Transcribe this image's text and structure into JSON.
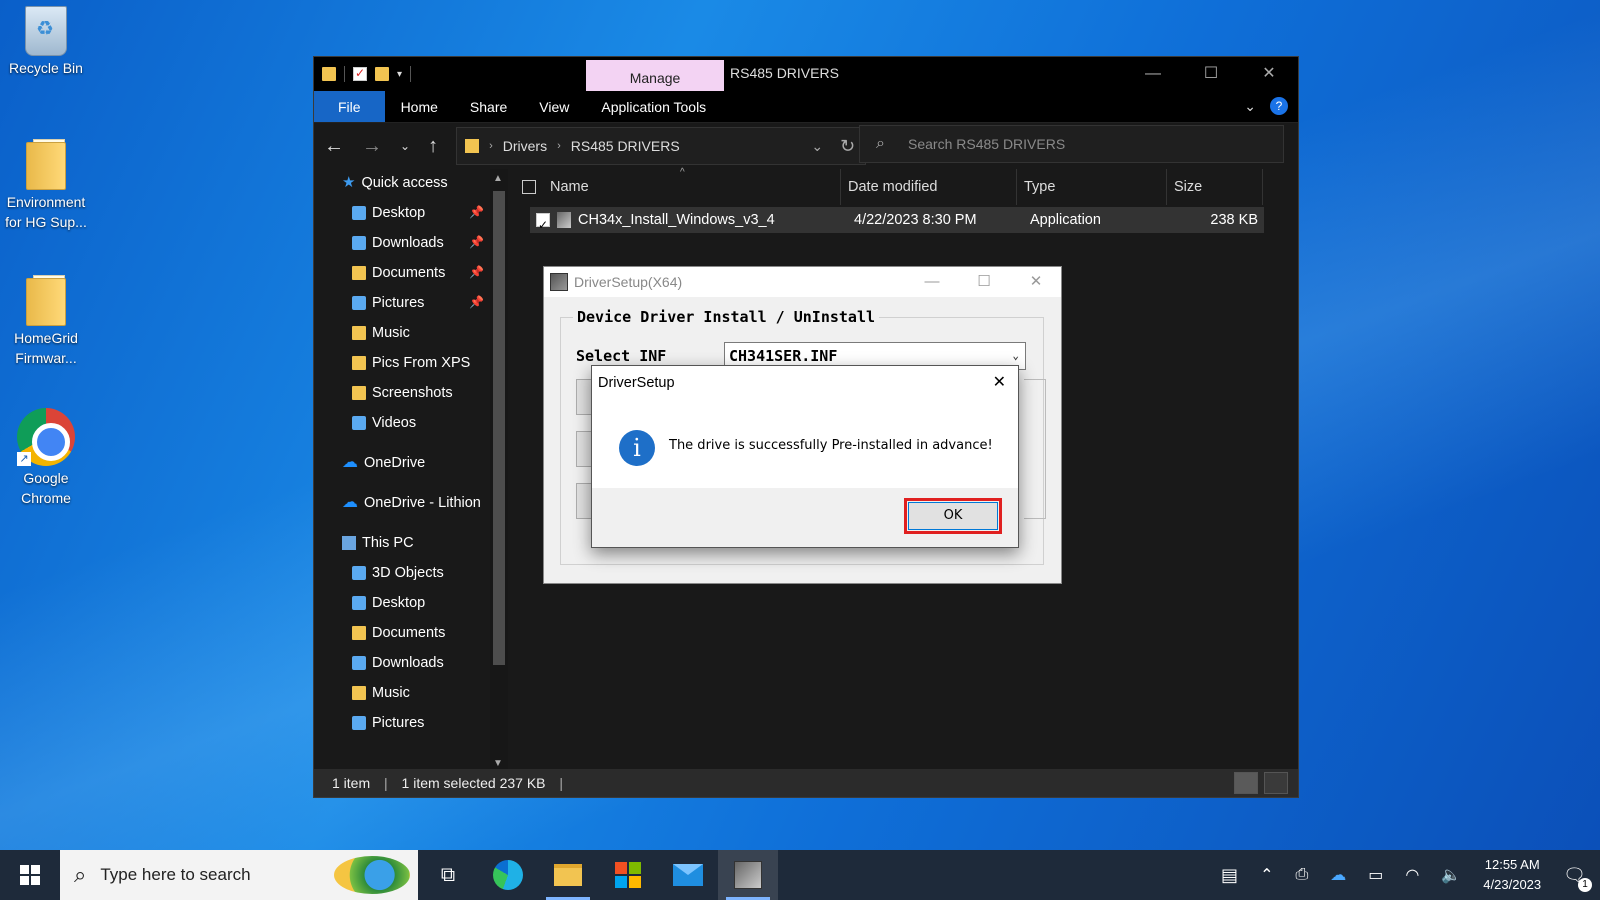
{
  "desktop": {
    "icons": [
      {
        "label": "Recycle Bin",
        "icon": "recycle-bin-icon"
      },
      {
        "label": "Environment for HG Sup...",
        "icon": "folder-icon"
      },
      {
        "label": "HomeGrid Firmwar...",
        "icon": "folder-icon"
      },
      {
        "label": "Google Chrome",
        "icon": "chrome-icon"
      }
    ]
  },
  "explorer": {
    "manage_tab": "Manage",
    "window_title": "RS485 DRIVERS",
    "ribbon": {
      "file": "File",
      "home": "Home",
      "share": "Share",
      "view": "View",
      "app_tools": "Application Tools"
    },
    "breadcrumb": {
      "parent": "Drivers",
      "current": "RS485 DRIVERS"
    },
    "search_placeholder": "Search RS485 DRIVERS",
    "nav": {
      "quick_access": "Quick access",
      "items": [
        "Desktop",
        "Downloads",
        "Documents",
        "Pictures",
        "Music",
        "Pics From XPS",
        "Screenshots",
        "Videos"
      ],
      "onedrive": "OneDrive",
      "onedrive_lithion": "OneDrive - Lithion",
      "this_pc": "This PC",
      "pc_items": [
        "3D Objects",
        "Desktop",
        "Documents",
        "Downloads",
        "Music",
        "Pictures"
      ]
    },
    "columns": {
      "name": "Name",
      "date": "Date modified",
      "type": "Type",
      "size": "Size"
    },
    "files": [
      {
        "name": "CH34x_Install_Windows_v3_4",
        "date": "4/22/2023 8:30 PM",
        "type": "Application",
        "size": "238 KB",
        "selected": true
      }
    ],
    "status": {
      "count": "1 item",
      "selected": "1 item selected  237 KB"
    }
  },
  "driver_setup": {
    "title": "DriverSetup(X64)",
    "group_label": "Device Driver Install / UnInstall",
    "select_label": "Select INF",
    "select_value": "CH341SER.INF"
  },
  "message_box": {
    "title": "DriverSetup",
    "message": "The drive is successfully Pre-installed in advance!",
    "ok_label": "OK"
  },
  "taskbar": {
    "search_placeholder": "Type here to search",
    "time": "12:55 AM",
    "date": "4/23/2023",
    "notification_count": "1"
  },
  "colors": {
    "accent": "#1766c6",
    "highlight_outline": "#e02020",
    "manage_tab": "#f3d3f3"
  }
}
